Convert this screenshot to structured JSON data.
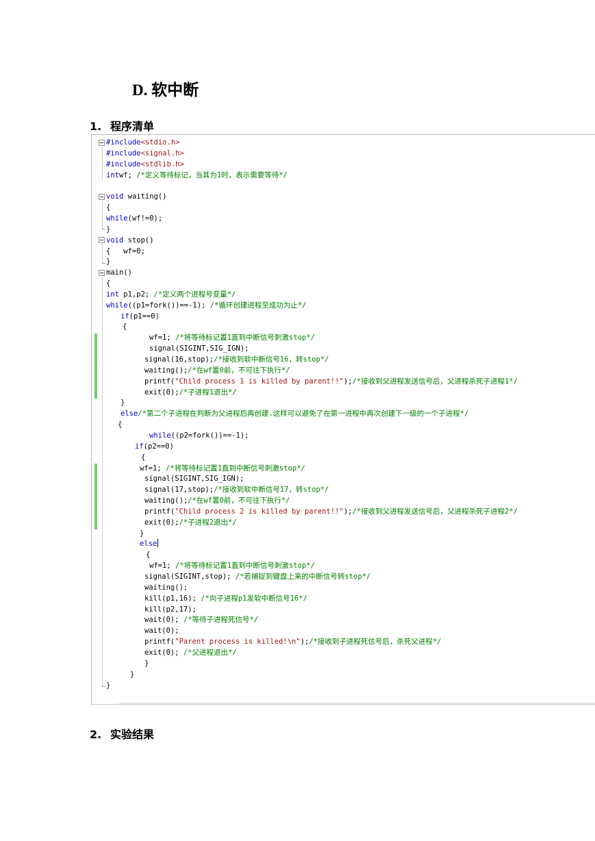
{
  "document": {
    "section_title": "D. 软中断",
    "headings": [
      {
        "number": "1.",
        "text": "程序清单"
      },
      {
        "number": "2.",
        "text": "实验结果"
      }
    ]
  },
  "code": {
    "lines": [
      {
        "indent": 0,
        "tokens": [
          [
            "pp",
            "#include"
          ],
          [
            "inc",
            "<stdio.h>"
          ]
        ]
      },
      {
        "indent": 0,
        "tokens": [
          [
            "pp",
            "#include"
          ],
          [
            "inc",
            "<signal.h>"
          ]
        ]
      },
      {
        "indent": 0,
        "tokens": [
          [
            "pp",
            "#include"
          ],
          [
            "inc",
            "<stdlib.h>"
          ]
        ]
      },
      {
        "indent": 0,
        "tokens": [
          [
            "kw",
            "int"
          ],
          [
            "",
            "wf; "
          ],
          [
            "cm",
            "/*定义等待标记，当其为1时，表示需要等待*/"
          ]
        ]
      },
      {
        "indent": 0,
        "tokens": []
      },
      {
        "indent": 0,
        "tokens": [
          [
            "kw",
            "void"
          ],
          [
            "",
            " waiting()"
          ]
        ]
      },
      {
        "indent": 0,
        "tokens": [
          [
            "",
            "{"
          ]
        ]
      },
      {
        "indent": 0,
        "tokens": [
          [
            "kw",
            "while"
          ],
          [
            "",
            "(wf!=0);"
          ]
        ]
      },
      {
        "indent": 0,
        "tokens": [
          [
            "",
            "}"
          ]
        ]
      },
      {
        "indent": 0,
        "tokens": [
          [
            "kw",
            "void"
          ],
          [
            "",
            " stop()"
          ]
        ]
      },
      {
        "indent": 0,
        "tokens": [
          [
            "",
            "{   wf=0;"
          ]
        ]
      },
      {
        "indent": 0,
        "tokens": [
          [
            "",
            "}"
          ]
        ]
      },
      {
        "indent": 0,
        "tokens": [
          [
            "",
            "main()"
          ]
        ]
      },
      {
        "indent": 0,
        "tokens": [
          [
            "",
            "{"
          ]
        ]
      },
      {
        "indent": 0,
        "tokens": [
          [
            "kw",
            "int"
          ],
          [
            "",
            " p1,p2; "
          ],
          [
            "cm",
            "/*定义两个进程号变量*/"
          ]
        ]
      },
      {
        "indent": 0,
        "tokens": [
          [
            "kw",
            "while"
          ],
          [
            "",
            "((p1=fork())==-1); "
          ],
          [
            "cm",
            "/*循环创建进程至成功为止*/"
          ]
        ]
      },
      {
        "indent": 21,
        "tokens": [
          [
            "kw",
            "if"
          ],
          [
            "",
            "(p1==0)"
          ]
        ]
      },
      {
        "indent": 24,
        "tokens": [
          [
            "",
            "{"
          ]
        ]
      },
      {
        "indent": 63,
        "tokens": [
          [
            "",
            "wf=1; "
          ],
          [
            "cm",
            "/*将等待标记置1直到中断信号刺激stop*/"
          ]
        ]
      },
      {
        "indent": 63,
        "tokens": [
          [
            "",
            "signal(SIGINT,SIG_IGN);"
          ]
        ]
      },
      {
        "indent": 56,
        "tokens": [
          [
            "",
            "signal(16,stop);"
          ],
          [
            "cm",
            "/*接收到软中断信号16，转stop*/"
          ]
        ]
      },
      {
        "indent": 56,
        "tokens": [
          [
            "",
            "waiting();"
          ],
          [
            "cm",
            "/*在wf置0前，不可往下执行*/"
          ]
        ]
      },
      {
        "indent": 56,
        "tokens": [
          [
            "",
            "printf("
          ],
          [
            "str",
            "\"Child process 1 is killed by parent!!\""
          ],
          [
            "",
            ");"
          ],
          [
            "cm",
            "/*接收到父进程发送信号后，父进程杀死子进程1*/"
          ]
        ]
      },
      {
        "indent": 56,
        "tokens": [
          [
            "",
            "exit(0);"
          ],
          [
            "cm",
            "/*子进程1退出*/"
          ]
        ]
      },
      {
        "indent": 21,
        "tokens": [
          [
            "",
            "}"
          ]
        ]
      },
      {
        "indent": 21,
        "tokens": [
          [
            "kw",
            "else"
          ],
          [
            "cm",
            "/*第二个子进程在判断为父进程后再创建.这样可以避免了在第一进程中再次创建下一级的一个子进程*/"
          ]
        ]
      },
      {
        "indent": 17,
        "tokens": [
          [
            "",
            "{"
          ]
        ]
      },
      {
        "indent": 63,
        "tokens": [
          [
            "kw",
            "while"
          ],
          [
            "",
            "((p2=fork())==-1);"
          ]
        ]
      },
      {
        "indent": 42,
        "tokens": [
          [
            "kw",
            "if"
          ],
          [
            "",
            "(p2==0)"
          ]
        ]
      },
      {
        "indent": 51,
        "tokens": [
          [
            "",
            "{"
          ]
        ]
      },
      {
        "indent": 49,
        "tokens": [
          [
            "",
            "wf=1; "
          ],
          [
            "cm",
            "/*将等待标记置1直到中断信号刺激stop*/"
          ]
        ]
      },
      {
        "indent": 56,
        "tokens": [
          [
            "",
            "signal(SIGINT,SIG_IGN);"
          ]
        ]
      },
      {
        "indent": 56,
        "tokens": [
          [
            "",
            "signal(17,stop);"
          ],
          [
            "cm",
            "/*接收到软中断信号17，转stop*/"
          ]
        ]
      },
      {
        "indent": 56,
        "tokens": [
          [
            "",
            "waiting();"
          ],
          [
            "cm",
            "/*在wf置0前，不可往下执行*/"
          ]
        ]
      },
      {
        "indent": 56,
        "tokens": [
          [
            "",
            "printf("
          ],
          [
            "str",
            "\"Child process 2 is killed by parent!!\""
          ],
          [
            "",
            ");"
          ],
          [
            "cm",
            "/*接收到父进程发送信号后，父进程杀死子进程2*/"
          ]
        ]
      },
      {
        "indent": 56,
        "tokens": [
          [
            "",
            "exit(0);"
          ],
          [
            "cm",
            "/*子进程2退出*/"
          ]
        ]
      },
      {
        "indent": 49,
        "tokens": [
          [
            "",
            "}"
          ]
        ]
      },
      {
        "indent": 49,
        "tokens": [
          [
            "kw",
            "else"
          ]
        ],
        "caret": true
      },
      {
        "indent": 58,
        "tokens": [
          [
            "",
            "{"
          ]
        ]
      },
      {
        "indent": 63,
        "tokens": [
          [
            "",
            "wf=1; "
          ],
          [
            "cm",
            "/*将等待标记置1直到中断信号刺激stop*/"
          ]
        ]
      },
      {
        "indent": 56,
        "tokens": [
          [
            "",
            "signal(SIGINT,stop); "
          ],
          [
            "cm",
            "/*若捕捉到键盘上来的中断信号转stop*/"
          ]
        ]
      },
      {
        "indent": 56,
        "tokens": [
          [
            "",
            "waiting();"
          ]
        ]
      },
      {
        "indent": 56,
        "tokens": [
          [
            "",
            "kill(p1,16); "
          ],
          [
            "cm",
            "/*向子进程p1发软中断信号16*/"
          ]
        ]
      },
      {
        "indent": 56,
        "tokens": [
          [
            "",
            "kill(p2,17);"
          ]
        ]
      },
      {
        "indent": 56,
        "tokens": [
          [
            "",
            "wait(0); "
          ],
          [
            "cm",
            "/*等待子进程死信号*/"
          ]
        ]
      },
      {
        "indent": 56,
        "tokens": [
          [
            "",
            "wait(0);"
          ]
        ]
      },
      {
        "indent": 56,
        "tokens": [
          [
            "",
            "printf("
          ],
          [
            "str",
            "\"Parent process is killed!\\n\""
          ],
          [
            "",
            ");"
          ],
          [
            "cm",
            "/*接收到子进程死信号后，杀死父进程*/"
          ]
        ]
      },
      {
        "indent": 56,
        "tokens": [
          [
            "",
            "exit(0); "
          ],
          [
            "cm",
            "/*父进程退出*/"
          ]
        ]
      },
      {
        "indent": 56,
        "tokens": [
          [
            "",
            "}"
          ]
        ]
      },
      {
        "indent": 35,
        "tokens": [
          [
            "",
            "}"
          ]
        ]
      },
      {
        "indent": 0,
        "tokens": [
          [
            "",
            "}"
          ]
        ]
      }
    ]
  }
}
